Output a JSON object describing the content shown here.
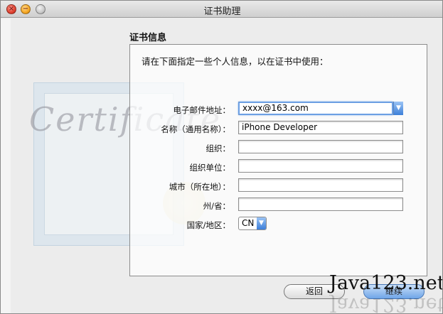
{
  "window": {
    "title": "证书助理"
  },
  "section": {
    "title": "证书信息",
    "instruction": "请在下面指定一些个人信息，以在证书中使用："
  },
  "background": {
    "certificate_word": "Certificate"
  },
  "form": {
    "email": {
      "label": "电子邮件地址：",
      "value": "xxxx@163.com"
    },
    "name": {
      "label": "名称（通用名称）：",
      "value": "iPhone Developer"
    },
    "org": {
      "label": "组织：",
      "value": ""
    },
    "unit": {
      "label": "组织单位：",
      "value": ""
    },
    "city": {
      "label": "城市（所在地）：",
      "value": ""
    },
    "state": {
      "label": "州/省：",
      "value": ""
    },
    "country": {
      "label": "国家/地区：",
      "value": "CN"
    }
  },
  "buttons": {
    "back": "返回",
    "continue": "继续"
  },
  "watermark": "Java123.net",
  "colors": {
    "accent": "#3d7fd9",
    "focus": "#6c9fe3"
  }
}
